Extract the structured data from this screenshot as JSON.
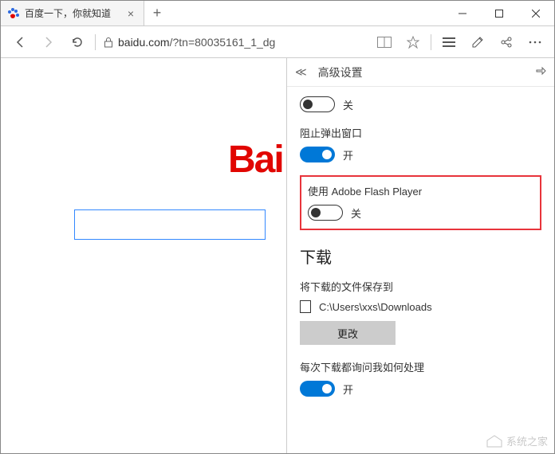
{
  "tab": {
    "title": "百度一下，你就知道"
  },
  "url": {
    "host": "baidu.com",
    "path": "/?tn=80035161_1_dg"
  },
  "page": {
    "logo": "Bai"
  },
  "panel": {
    "title": "高级设置",
    "setting1": {
      "state": "关"
    },
    "block_popup": {
      "label": "阻止弹出窗口",
      "state": "开"
    },
    "flash": {
      "label": "使用 Adobe Flash Player",
      "state": "关"
    },
    "download": {
      "title": "下载",
      "save_to_label": "将下载的文件保存到",
      "path": "C:\\Users\\xxs\\Downloads",
      "change_btn": "更改",
      "ask_label": "每次下载都询问我如何处理",
      "ask_state": "开"
    }
  },
  "watermark": "系统之家"
}
